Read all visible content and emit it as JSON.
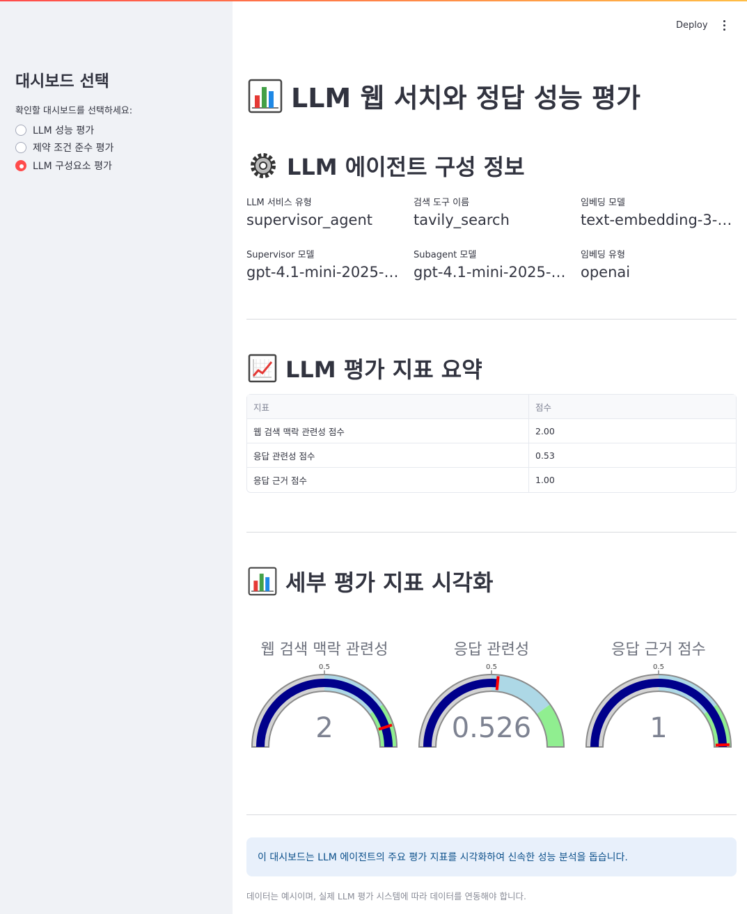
{
  "sidebar": {
    "title": "대시보드 선택",
    "label": "확인할 대시보드를 선택하세요:",
    "options": [
      "LLM 성능 평가",
      "제약 조건 준수 평가",
      "LLM 구성요소 평가"
    ],
    "selected_index": 2
  },
  "header": {
    "deploy": "Deploy"
  },
  "page": {
    "title": "LLM 웹 서치와 정답 성능 평가"
  },
  "config": {
    "heading": "LLM 에이전트 구성 정보",
    "metrics": [
      {
        "label": "LLM 서비스 유형",
        "value": "supervisor_agent"
      },
      {
        "label": "검색 도구 이름",
        "value": "tavily_search"
      },
      {
        "label": "임베딩 모델",
        "value": "text-embedding-3-s..."
      },
      {
        "label": "Supervisor 모델",
        "value": "gpt-4.1-mini-2025-0..."
      },
      {
        "label": "Subagent 모델",
        "value": "gpt-4.1-mini-2025-0..."
      },
      {
        "label": "임베딩 유형",
        "value": "openai"
      }
    ]
  },
  "summary": {
    "heading": "LLM 평가 지표 요약",
    "columns": [
      "지표",
      "점수"
    ],
    "rows": [
      [
        "웹 검색 맥락 관련성 점수",
        "2.00"
      ],
      [
        "응답 관련성 점수",
        "0.53"
      ],
      [
        "응답 근거 점수",
        "1.00"
      ]
    ]
  },
  "viz": {
    "heading": "세부 평가 지표 시각화",
    "colors": {
      "bar": "#00008b",
      "low": "#d3d3d3",
      "mid": "#add8e6",
      "high": "#90ee90",
      "threshold": "#ff0000"
    }
  },
  "chart_data": [
    {
      "type": "gauge",
      "title": "웹 검색 맥락 관련성",
      "value": 2,
      "display": "2",
      "range": [
        0,
        1
      ],
      "tick_label": "0.5",
      "steps": [
        [
          0,
          0.5
        ],
        [
          0.5,
          0.8
        ],
        [
          0.8,
          1
        ]
      ],
      "threshold": 0.9
    },
    {
      "type": "gauge",
      "title": "응답 관련성",
      "value": 0.526,
      "display": "0.526",
      "range": [
        0,
        1
      ],
      "tick_label": "0.5",
      "steps": [
        [
          0,
          0.5
        ],
        [
          0.5,
          0.8
        ],
        [
          0.8,
          1
        ]
      ],
      "threshold": 0.53
    },
    {
      "type": "gauge",
      "title": "응답 근거 점수",
      "value": 1,
      "display": "1",
      "range": [
        0,
        1
      ],
      "tick_label": "0.5",
      "steps": [
        [
          0,
          0.5
        ],
        [
          0.5,
          0.8
        ],
        [
          0.8,
          1
        ]
      ],
      "threshold": 0.99
    }
  ],
  "footer": {
    "info": "이 대시보드는 LLM 에이전트의 주요 평가 지표를 시각화하여 신속한 성능 분석을 돕습니다.",
    "caption": "데이터는 예시이며, 실제 LLM 평가 시스템에 따라 데이터를 연동해야 합니다."
  }
}
